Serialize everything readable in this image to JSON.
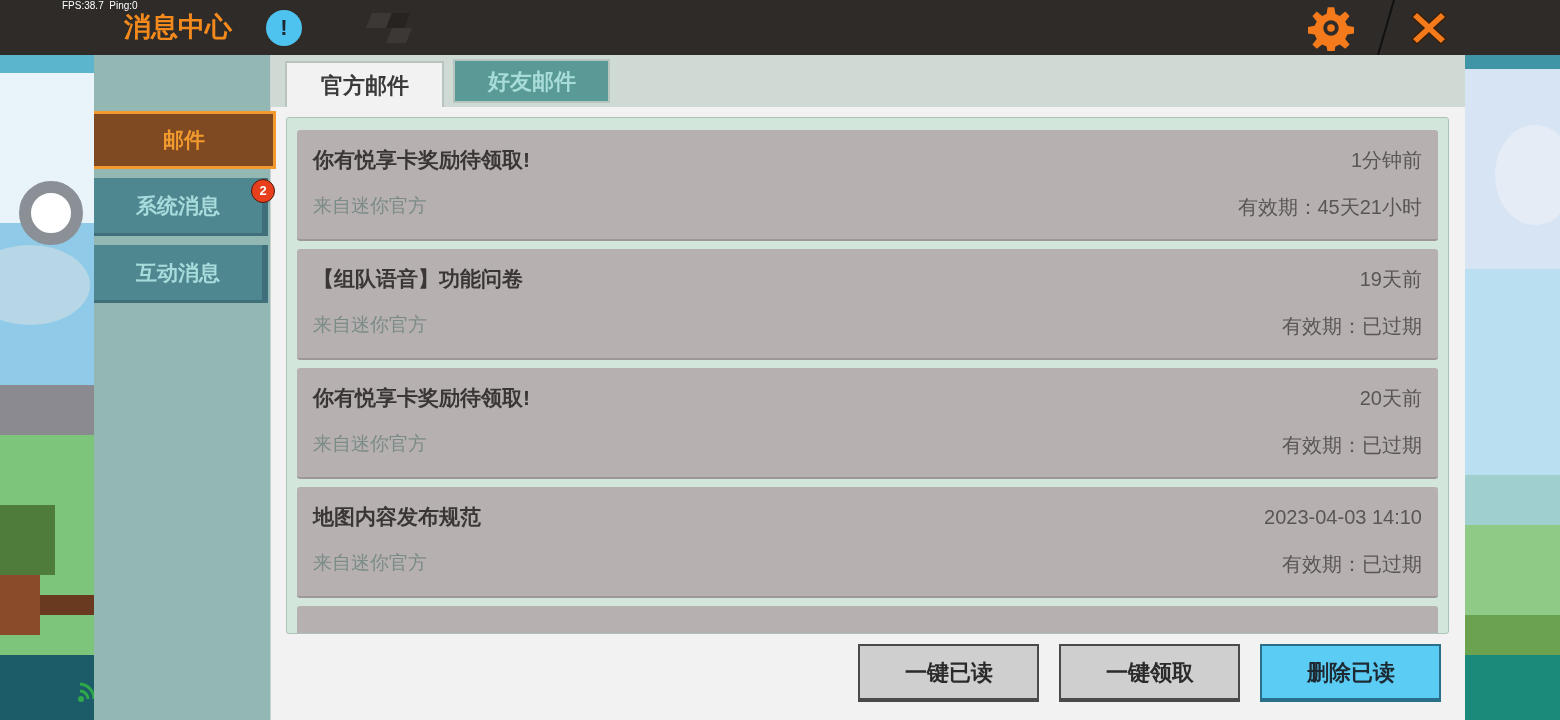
{
  "status_overlay": {
    "fps": "FPS:38.7",
    "ping": "Ping:0"
  },
  "window": {
    "title": "消息中心",
    "info_mark": "!"
  },
  "sidebar": {
    "items": [
      {
        "label": "邮件",
        "selected": true
      },
      {
        "label": "系统消息",
        "selected": false,
        "badge": "2"
      },
      {
        "label": "互动消息",
        "selected": false
      }
    ]
  },
  "tabs": [
    {
      "label": "官方邮件",
      "selected": true
    },
    {
      "label": "好友邮件",
      "selected": false
    }
  ],
  "mails": [
    {
      "title": "你有悦享卡奖励待领取!",
      "time": "1分钟前",
      "sender": "来自迷你官方",
      "validity": "有效期：45天21小时"
    },
    {
      "title": "【组队语音】功能问卷",
      "time": "19天前",
      "sender": "来自迷你官方",
      "validity": "有效期：已过期"
    },
    {
      "title": "你有悦享卡奖励待领取!",
      "time": "20天前",
      "sender": "来自迷你官方",
      "validity": "有效期：已过期"
    },
    {
      "title": "地图内容发布规范",
      "time": "2023-04-03 14:10",
      "sender": "来自迷你官方",
      "validity": "有效期：已过期"
    }
  ],
  "buttons": [
    {
      "label": "一键已读",
      "kind": "normal"
    },
    {
      "label": "一键领取",
      "kind": "normal"
    },
    {
      "label": "删除已读",
      "kind": "primary"
    }
  ]
}
